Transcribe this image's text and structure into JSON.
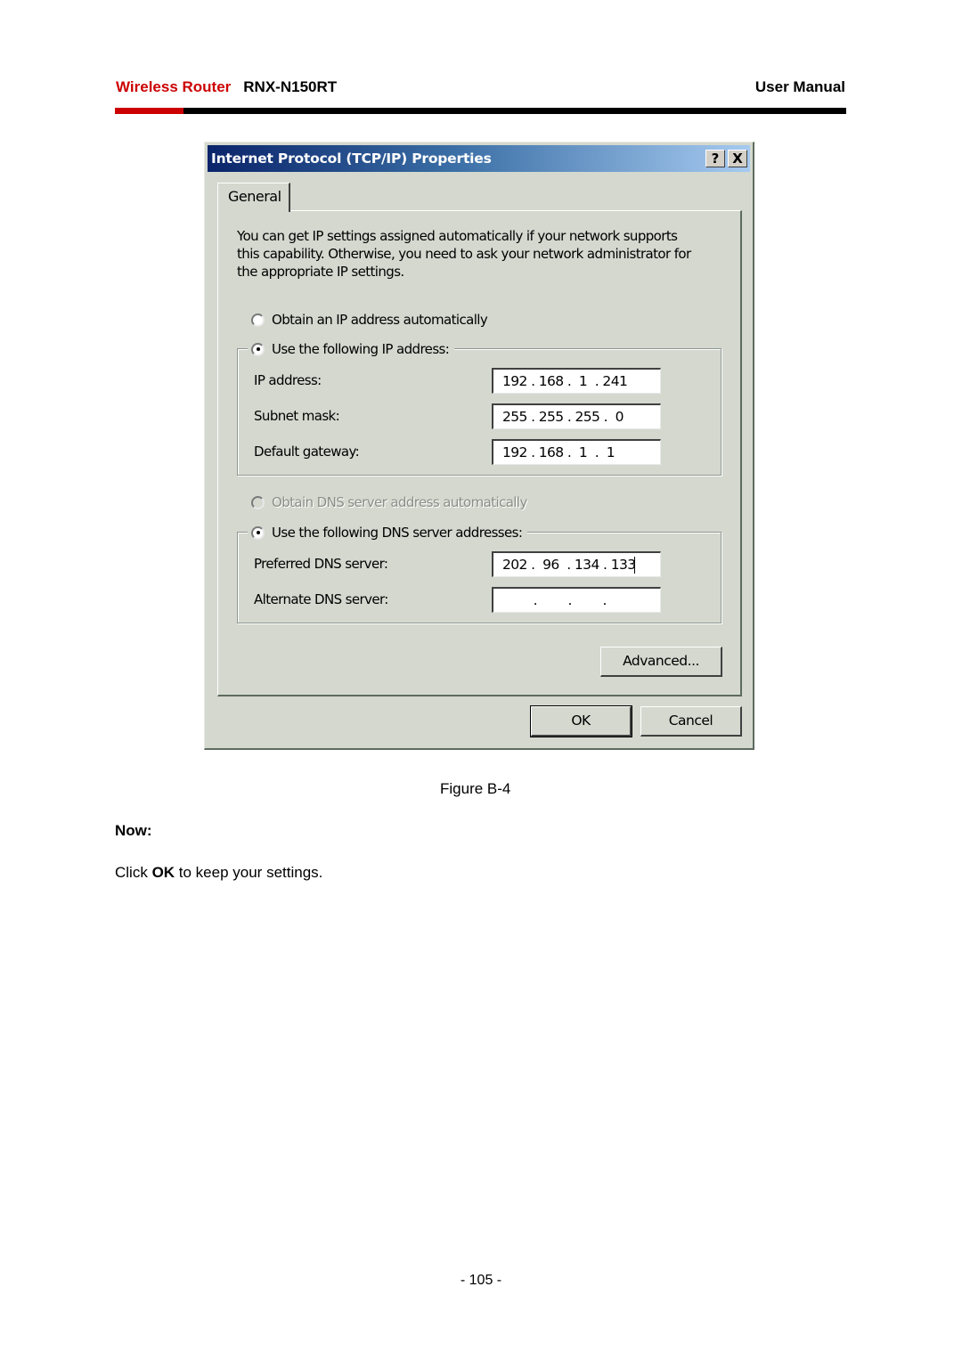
{
  "header": {
    "brand": "Wireless Router",
    "model": "RNX-N150RT",
    "doc_type": "User Manual",
    "accent_color": "#cc0000"
  },
  "dialog": {
    "title": "Internet Protocol (TCP/IP) Properties",
    "help_button": "?",
    "close_button": "X",
    "tab": "General",
    "intro_lines": [
      "You can get IP settings assigned automatically if your network supports",
      "this capability. Otherwise, you need to ask your network administrator for",
      "the appropriate IP settings."
    ],
    "ip_mode": {
      "auto_label": "Obtain an IP address automatically",
      "auto_checked": false,
      "manual_label": "Use the following IP address:",
      "manual_checked": true
    },
    "ip_fields": [
      {
        "label": "IP address:",
        "value": "192 . 168 .  1  . 241"
      },
      {
        "label": "Subnet mask:",
        "value": "255 . 255 . 255 .  0"
      },
      {
        "label": "Default gateway:",
        "value": "192 . 168 .  1  .  1"
      }
    ],
    "dns_mode": {
      "auto_label": "Obtain DNS server address automatically",
      "auto_checked": false,
      "auto_disabled": true,
      "manual_label": "Use the following DNS server addresses:",
      "manual_checked": true
    },
    "dns_fields": [
      {
        "label": "Preferred DNS server:",
        "value": "202 .  96  . 134 . 133"
      },
      {
        "label": "Alternate DNS server:",
        "value": "        .        .        ."
      }
    ],
    "advanced_button": "Advanced...",
    "ok_button": "OK",
    "cancel_button": "Cancel"
  },
  "figure_caption": "Figure B-4",
  "now_heading": "Now:",
  "instruction": {
    "prefix": "Click ",
    "bold": "OK",
    "suffix": " to keep your settings."
  },
  "page_number": "- 105 -"
}
